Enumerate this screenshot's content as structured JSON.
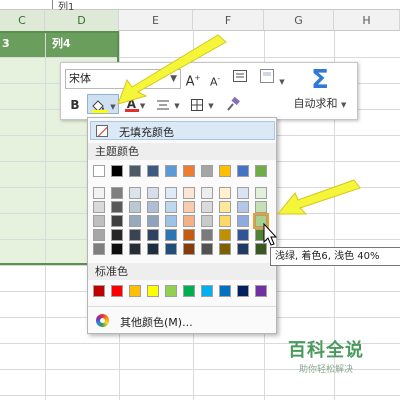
{
  "formula_bar": {
    "content": "列1"
  },
  "columns": {
    "headers": [
      "C",
      "D",
      "E",
      "F",
      "G",
      "H"
    ],
    "selected": [
      "C",
      "D"
    ]
  },
  "table": {
    "header_cells": [
      "3",
      "列4"
    ],
    "header_color": "#6a9e5c",
    "band_color": "#e6f1de"
  },
  "toolbar": {
    "font_name": "宋体",
    "grow_font": "A",
    "shrink_font": "A",
    "bold": "B",
    "font_color_letter": "A",
    "autosum_label": "自动求和",
    "sigma": "Σ"
  },
  "fill_dropdown": {
    "no_fill_label": "无填充颜色",
    "theme_label": "主题颜色",
    "standard_label": "标准色",
    "other_label": "其他颜色(M)...",
    "theme_top_row": [
      "#ffffff",
      "#000000",
      "#4e5a66",
      "#3d5a80",
      "#5b9bd5",
      "#ed7d31",
      "#a5a5a5",
      "#ffc000",
      "#4472c4",
      "#70ad47"
    ],
    "theme_shades": [
      [
        "#f2f2f2",
        "#7f7f7f",
        "#dde3ea",
        "#d6dee9",
        "#deebf7",
        "#fbe5d6",
        "#ededed",
        "#fff2cc",
        "#dae3f3",
        "#e2f0d9"
      ],
      [
        "#d9d9d9",
        "#595959",
        "#bac7d4",
        "#adbfd4",
        "#bdd7ee",
        "#f8cbad",
        "#dbdbdb",
        "#ffe699",
        "#b4c7e7",
        "#c5e0b4"
      ],
      [
        "#bfbfbf",
        "#3f3f3f",
        "#97a9bd",
        "#8fa3bf",
        "#9dc3e6",
        "#f4b183",
        "#c9c9c9",
        "#ffd966",
        "#8faadc",
        "#a9d18e"
      ],
      [
        "#a6a6a6",
        "#262626",
        "#3a4450",
        "#2d4360",
        "#2e75b6",
        "#c55a11",
        "#7b7b7b",
        "#bf9000",
        "#2f5597",
        "#548235"
      ],
      [
        "#7f7f7f",
        "#0d0d0d",
        "#272d35",
        "#1e2d40",
        "#1f4e79",
        "#843c0c",
        "#525252",
        "#7f6000",
        "#203864",
        "#385723"
      ]
    ],
    "highlighted_swatch": {
      "row": 2,
      "col": 9
    },
    "standard_colors": [
      "#c00000",
      "#ff0000",
      "#ffc000",
      "#ffff00",
      "#92d050",
      "#00b050",
      "#00b0f0",
      "#0070c0",
      "#002060",
      "#7030a0"
    ]
  },
  "tooltip": {
    "text": "浅绿, 着色6, 浅色 40%"
  },
  "watermark": {
    "title": "百科全说",
    "subtitle": "助你轻松解决"
  },
  "colors": {
    "arrow": "#f5f53a",
    "arrow_outline": "#d4c81c",
    "fill_icon_bar": "#ffff00",
    "font_color_bar": "#e03030"
  }
}
